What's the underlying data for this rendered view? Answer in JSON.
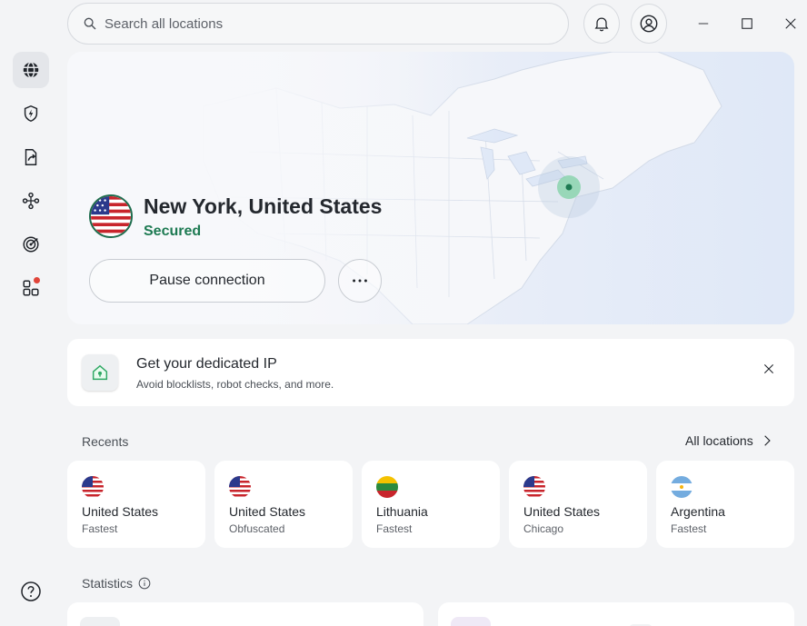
{
  "search": {
    "placeholder": "Search all locations"
  },
  "connection": {
    "location": "New York, United States",
    "status": "Secured",
    "pause_label": "Pause connection"
  },
  "promo": {
    "title": "Get your dedicated IP",
    "subtitle": "Avoid blocklists, robot checks, and more."
  },
  "recents": {
    "title": "Recents",
    "all_locations": "All locations",
    "items": [
      {
        "country": "United States",
        "detail": "Fastest",
        "flag": "us"
      },
      {
        "country": "United States",
        "detail": "Obfuscated",
        "flag": "us"
      },
      {
        "country": "Lithuania",
        "detail": "Fastest",
        "flag": "lt"
      },
      {
        "country": "United States",
        "detail": "Chicago",
        "flag": "us"
      },
      {
        "country": "Argentina",
        "detail": "Fastest",
        "flag": "ar"
      }
    ]
  },
  "statistics": {
    "title": "Statistics"
  },
  "sidebar": {
    "items": [
      {
        "icon": "globe-icon",
        "active": true
      },
      {
        "icon": "shield-bolt-icon"
      },
      {
        "icon": "file-share-icon"
      },
      {
        "icon": "meshnet-icon"
      },
      {
        "icon": "radar-icon"
      },
      {
        "icon": "apps-icon",
        "badge": true
      }
    ],
    "help_icon": "help-icon"
  },
  "colors": {
    "secured_green": "#1d7a52",
    "accent_red": "#e0453a",
    "map_water": "#dfe8f7"
  }
}
